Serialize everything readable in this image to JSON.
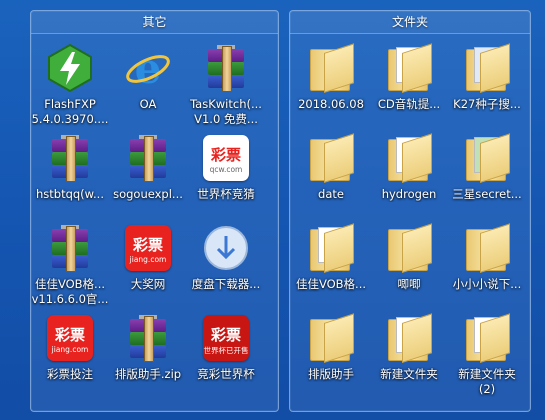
{
  "left_fence": {
    "title": "其它",
    "items": [
      {
        "name": "FlashFXP",
        "line1": "FlashFXP",
        "line2": "5.4.0.3970....",
        "icon": "flashfxp-icon"
      },
      {
        "name": "OA",
        "line1": "OA",
        "line2": "",
        "icon": "ie-icon"
      },
      {
        "name": "TasKwitch",
        "line1": "TasKwitch(...",
        "line2": "V1.0 免费...",
        "icon": "winrar-icon"
      },
      {
        "name": "hstbtqq",
        "line1": "hstbtqq(w...",
        "line2": "",
        "icon": "winrar-icon"
      },
      {
        "name": "sogouexpl",
        "line1": "sogouexpl...",
        "line2": "",
        "icon": "winrar-icon"
      },
      {
        "name": "world-cup-quiz",
        "line1": "世界杯竞猜",
        "line2": "",
        "icon": "caipiao-icon",
        "sub": "qcw.com"
      },
      {
        "name": "jiajia-vob",
        "line1": "佳佳VOB格...",
        "line2": "v11.6.6.0官...",
        "icon": "winrar-icon"
      },
      {
        "name": "dajiang",
        "line1": "大奖网",
        "line2": "",
        "icon": "caipiao-red-icon",
        "sub": "jiang.com"
      },
      {
        "name": "dupan",
        "line1": "度盘下载器...",
        "line2": "",
        "icon": "download-icon"
      },
      {
        "name": "caipiao-touzhu",
        "line1": "彩票投注",
        "line2": "",
        "icon": "caipiao-red-icon",
        "sub": "jiang.com"
      },
      {
        "name": "paiban-zip",
        "line1": "排版助手.zip",
        "line2": "",
        "icon": "winrar-icon"
      },
      {
        "name": "jingcai-worldcup",
        "line1": "竞彩世界杯",
        "line2": "",
        "icon": "caipiao-red-icon",
        "sub": "世界杯已开售"
      }
    ]
  },
  "right_fence": {
    "title": "文件夹",
    "items": [
      {
        "name": "folder-2018",
        "line1": "2018.06.08",
        "line2": "",
        "icon": "folder-icon"
      },
      {
        "name": "folder-cd",
        "line1": "CD音轨提...",
        "line2": "",
        "icon": "folder-icon"
      },
      {
        "name": "folder-k27",
        "line1": "K27种子搜...",
        "line2": "",
        "icon": "folder-icon"
      },
      {
        "name": "folder-date",
        "line1": "date",
        "line2": "",
        "icon": "folder-icon"
      },
      {
        "name": "folder-hydrogen",
        "line1": "hydrogen",
        "line2": "",
        "icon": "folder-icon"
      },
      {
        "name": "folder-samsung",
        "line1": "三星secret...",
        "line2": "",
        "icon": "folder-icon"
      },
      {
        "name": "folder-jiajia",
        "line1": "佳佳VOB格...",
        "line2": "",
        "icon": "folder-icon"
      },
      {
        "name": "folder-jiji",
        "line1": "唧唧",
        "line2": "",
        "icon": "folder-icon"
      },
      {
        "name": "folder-xiaoshuo",
        "line1": "小小小说下...",
        "line2": "",
        "icon": "folder-icon"
      },
      {
        "name": "folder-paiban",
        "line1": "排版助手",
        "line2": "",
        "icon": "folder-icon"
      },
      {
        "name": "folder-new",
        "line1": "新建文件夹",
        "line2": "",
        "icon": "folder-icon"
      },
      {
        "name": "folder-new-2",
        "line1": "新建文件夹",
        "line2": "(2)",
        "icon": "folder-icon"
      }
    ]
  },
  "colors": {
    "accent": "#1a63bd",
    "folder": "#f3d987",
    "caipiao_red": "#e8231f"
  }
}
